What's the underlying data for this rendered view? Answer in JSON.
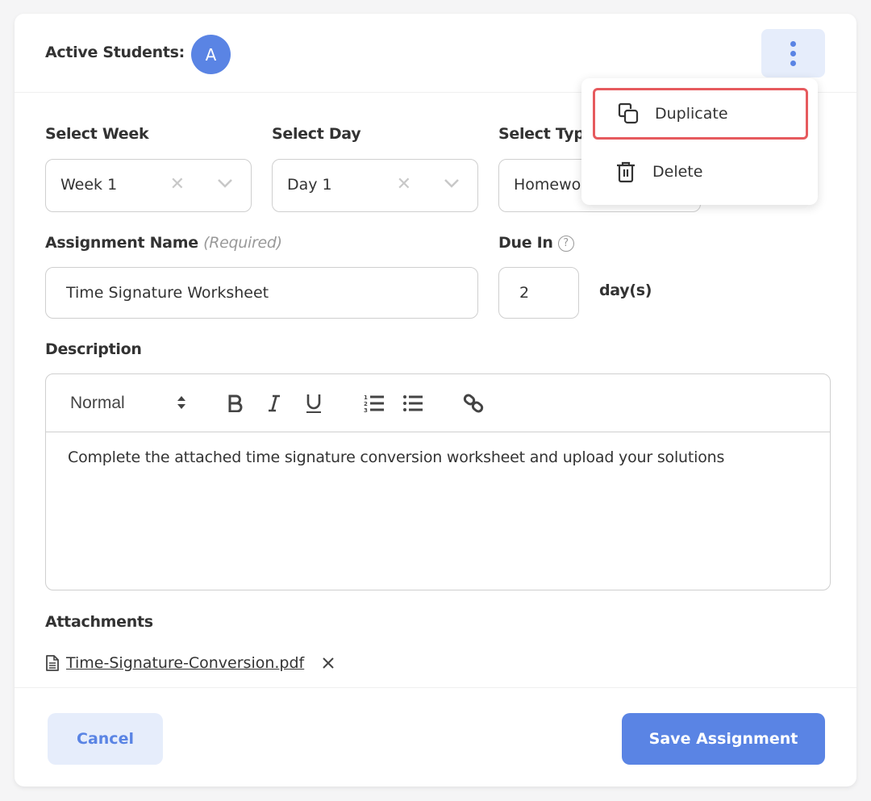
{
  "header": {
    "active_students_label": "Active Students:",
    "avatar_initial": "A",
    "more_options_icon": "kebab-vertical-icon"
  },
  "form": {
    "week": {
      "label": "Select Week",
      "value": "Week 1"
    },
    "day": {
      "label": "Select Day",
      "value": "Day 1"
    },
    "type": {
      "label": "Select Type",
      "value": "Homework"
    },
    "assignment_name": {
      "label": "Assignment Name",
      "required_hint": "(Required)",
      "value": "Time Signature Worksheet"
    },
    "due_in": {
      "label": "Due In",
      "value": "2",
      "unit": "day(s)",
      "help_icon": "question-circle-icon"
    },
    "description": {
      "label": "Description",
      "toolbar": {
        "format_select": "Normal",
        "buttons": [
          "bold",
          "italic",
          "underline",
          "ordered-list",
          "bullet-list",
          "link"
        ]
      },
      "content": "Complete the attached time signature conversion worksheet and upload your solutions"
    },
    "attachments": {
      "label": "Attachments",
      "files": [
        {
          "name": "Time-Signature-Conversion.pdf"
        }
      ]
    }
  },
  "footer": {
    "cancel_label": "Cancel",
    "save_label": "Save Assignment"
  },
  "menu": {
    "items": [
      {
        "label": "Duplicate",
        "icon": "copy-icon",
        "highlighted": true
      },
      {
        "label": "Delete",
        "icon": "trash-icon",
        "highlighted": false
      }
    ]
  },
  "colors": {
    "accent": "#5a84e4",
    "accent_light": "#e6edfb",
    "highlight_border": "#e65a5e"
  }
}
